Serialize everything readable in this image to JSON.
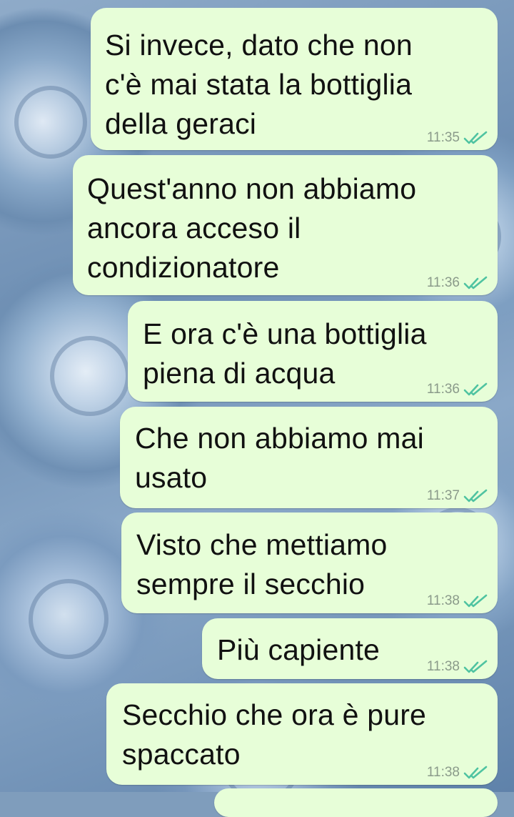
{
  "chat": {
    "messages": [
      {
        "text": "Si invece, dato che non\nc'è mai stata la bottiglia\ndella geraci",
        "time": "11:35",
        "status": "read"
      },
      {
        "text": "Quest'anno non abbiamo\nancora acceso il\ncondizionatore",
        "time": "11:36",
        "status": "read"
      },
      {
        "text": "E ora c'è una bottiglia\npiena di acqua",
        "time": "11:36",
        "status": "read"
      },
      {
        "text": "Che non abbiamo mai\nusato",
        "time": "11:37",
        "status": "read"
      },
      {
        "text": "Visto che mettiamo\nsempre il secchio",
        "time": "11:38",
        "status": "read"
      },
      {
        "text": "Più capiente",
        "time": "11:38",
        "status": "read"
      },
      {
        "text": "Secchio che ora è pure\nspaccato",
        "time": "11:38",
        "status": "read"
      }
    ]
  },
  "colors": {
    "outgoing_bubble": "#e7fed8",
    "read_ticks": "#4fc3a1",
    "wallpaper": "#7f9dbc"
  },
  "icons": {
    "read_status": "double-check-icon"
  }
}
